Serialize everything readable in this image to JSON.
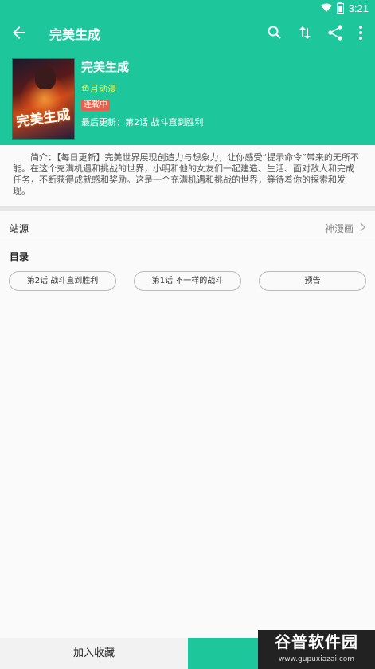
{
  "status_bar": {
    "time": "3:21",
    "icons": [
      "wifi-icon",
      "battery-icon"
    ]
  },
  "toolbar": {
    "title": "完美生成",
    "icons": [
      "back-arrow-icon",
      "search-icon",
      "sort-icon",
      "share-icon",
      "more-vert-icon"
    ]
  },
  "comic": {
    "title": "完美生成",
    "author": "鱼月动漫",
    "status_badge": "连载中",
    "latest_update": "最后更新：第2话 战斗直到胜利",
    "cover_text": "完美生成",
    "intro": "简介：【每日更新】完美世界展现创造力与想象力，让你感受“提示命令”带来的无所不能。在这个充满机遇和挑战的世界，小明和他的女友们一起建造、生活、面对敌人和完成任务，不断获得成就感和奖励。这是一个充满机遇和挑战的世界，等待着你的探索和发现。"
  },
  "source": {
    "label": "站源",
    "value": "神漫画"
  },
  "toc": {
    "label": "目录",
    "chapters": [
      "第2话 战斗直到胜利",
      "第1话 不一样的战斗",
      "预告"
    ]
  },
  "bottom_bar": {
    "favorite_label": "加入收藏",
    "read_label": ""
  },
  "watermark": {
    "title": "谷普软件园",
    "url": "www.gupuxiazai.com"
  },
  "colors": {
    "accent": "#1ec79b",
    "author": "#f5f542",
    "badge": "#e8604c"
  }
}
